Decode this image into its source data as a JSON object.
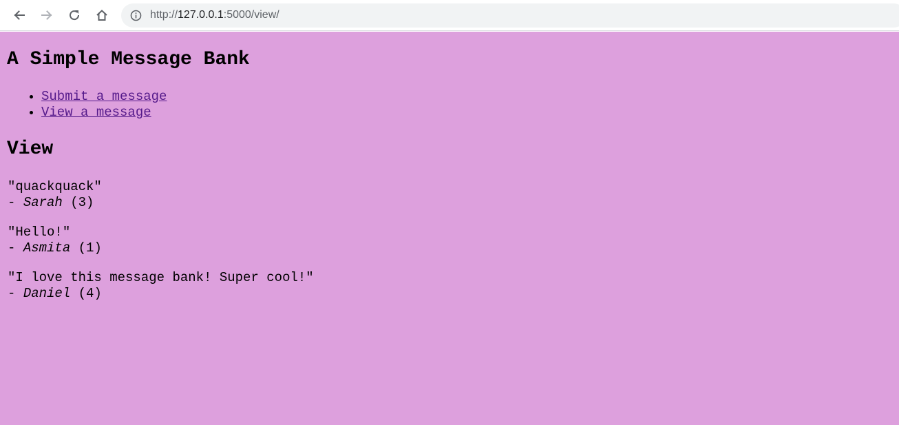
{
  "browser": {
    "url_prefix": "http://",
    "url_host": "127.0.0.1",
    "url_rest": ":5000/view/",
    "icons": [
      "back-arrow-icon",
      "forward-arrow-icon",
      "reload-icon",
      "home-icon",
      "info-icon"
    ]
  },
  "page": {
    "background_color": "#dda0dd",
    "link_color": "#551a8b",
    "title": "A Simple Message Bank",
    "nav": [
      {
        "label": "Submit a message"
      },
      {
        "label": "View a message"
      }
    ],
    "section_title": "View",
    "messages": [
      {
        "text": "\"quackquack\"",
        "dash": "- ",
        "author": "Sarah",
        "id": " (3)"
      },
      {
        "text": "\"Hello!\"",
        "dash": "- ",
        "author": "Asmita",
        "id": " (1)"
      },
      {
        "text": "\"I love this message bank! Super cool!\"",
        "dash": "- ",
        "author": "Daniel",
        "id": " (4)"
      }
    ]
  }
}
